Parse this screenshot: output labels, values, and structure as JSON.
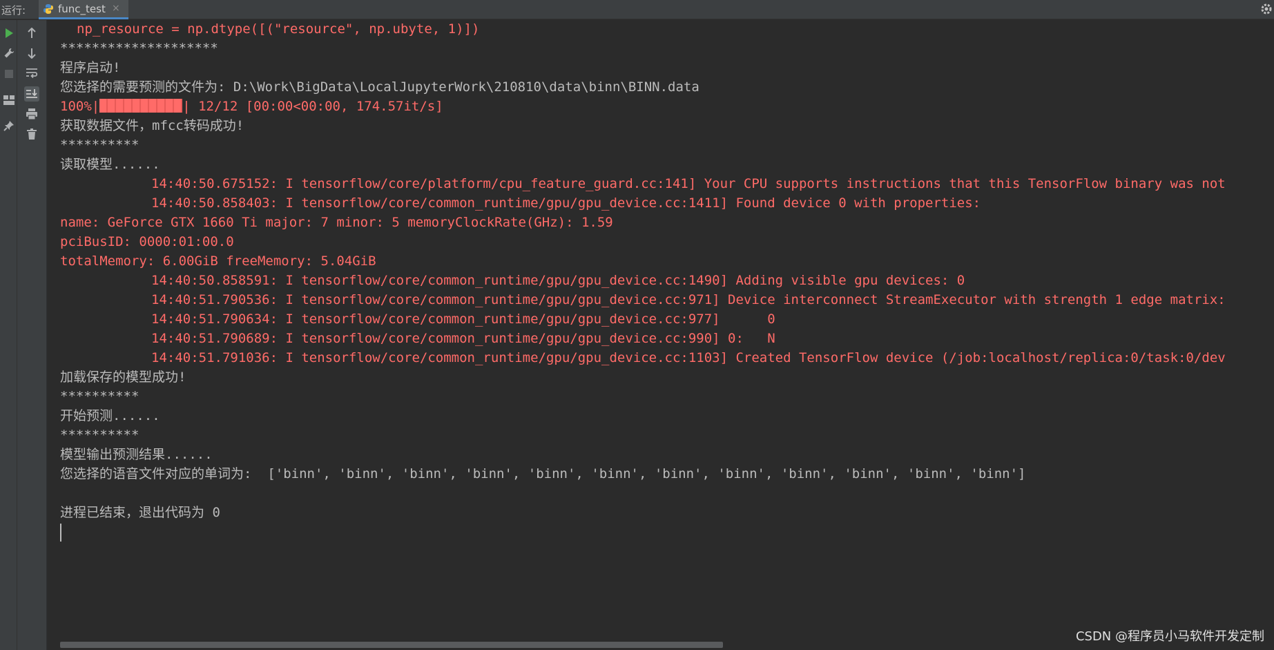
{
  "header": {
    "run_label": "运行:",
    "tab_label": "func_test",
    "tab_close": "×"
  },
  "left_toolbar": {
    "items": [
      "run-icon",
      "wrench-icon",
      "stop-icon",
      "layout-icon",
      "pin-icon"
    ]
  },
  "inner_toolbar": {
    "items": [
      "arrow-up-icon",
      "arrow-down-icon",
      "soft-wrap-icon",
      "scroll-to-end-icon",
      "print-icon",
      "trash-icon"
    ]
  },
  "console": {
    "lines": [
      {
        "text": "np_resource = np.dtype([(\"resource\", np.ubyte, 1)])",
        "style": "err"
      },
      {
        "text": "********************",
        "style": "normal"
      },
      {
        "text": "程序启动!",
        "style": "normal"
      },
      {
        "text": "您选择的需要预测的文件为: D:\\Work\\BigData\\LocalJupyterWork\\210810\\data\\binn\\BINN.data",
        "style": "normal"
      },
      {
        "text": "| 12/12 [00:00<00:00, 174.57it/s]",
        "prefix": "100%|",
        "style": "err"
      },
      {
        "text": "获取数据文件，mfcc转码成功!",
        "style": "normal"
      },
      {
        "text": "**********",
        "style": "normal"
      },
      {
        "text": "读取模型......",
        "style": "normal"
      },
      {
        "text": "14:40:50.675152: I tensorflow/core/platform/cpu_feature_guard.cc:141] Your CPU supports instructions that this TensorFlow binary was not",
        "style": "err"
      },
      {
        "text": "14:40:50.858403: I tensorflow/core/common_runtime/gpu/gpu_device.cc:1411] Found device 0 with properties:",
        "style": "err"
      },
      {
        "text": "name: GeForce GTX 1660 Ti major: 7 minor: 5 memoryClockRate(GHz): 1.59",
        "style": "err"
      },
      {
        "text": "pciBusID: 0000:01:00.0",
        "style": "err"
      },
      {
        "text": "totalMemory: 6.00GiB freeMemory: 5.04GiB",
        "style": "err"
      },
      {
        "text": "14:40:50.858591: I tensorflow/core/common_runtime/gpu/gpu_device.cc:1490] Adding visible gpu devices: 0",
        "style": "err"
      },
      {
        "text": "14:40:51.790536: I tensorflow/core/common_runtime/gpu/gpu_device.cc:971] Device interconnect StreamExecutor with strength 1 edge matrix:",
        "style": "err"
      },
      {
        "text": "14:40:51.790634: I tensorflow/core/common_runtime/gpu/gpu_device.cc:977]      0",
        "style": "err"
      },
      {
        "text": "14:40:51.790689: I tensorflow/core/common_runtime/gpu/gpu_device.cc:990] 0:   N",
        "style": "err"
      },
      {
        "text": "14:40:51.791036: I tensorflow/core/common_runtime/gpu/gpu_device.cc:1103] Created TensorFlow device (/job:localhost/replica:0/task:0/dev",
        "style": "err"
      },
      {
        "text": "加载保存的模型成功!",
        "style": "normal"
      },
      {
        "text": "**********",
        "style": "normal"
      },
      {
        "text": "开始预测......",
        "style": "normal"
      },
      {
        "text": "**********",
        "style": "normal"
      },
      {
        "text": "模型输出预测结果......",
        "style": "normal"
      },
      {
        "text": "您选择的语音文件对应的单词为:  ['binn', 'binn', 'binn', 'binn', 'binn', 'binn', 'binn', 'binn', 'binn', 'binn', 'binn', 'binn']",
        "style": "normal"
      },
      {
        "text": "",
        "style": "normal"
      },
      {
        "text": "进程已结束，退出代码为 0",
        "style": "normal"
      }
    ]
  },
  "watermark": "CSDN @程序员小马软件开发定制",
  "colors": {
    "background": "#2b2b2b",
    "toolbar": "#3c3f41",
    "normal_text": "#bbbbbb",
    "error_text": "#ff6b68",
    "run_green": "#4caf50"
  }
}
